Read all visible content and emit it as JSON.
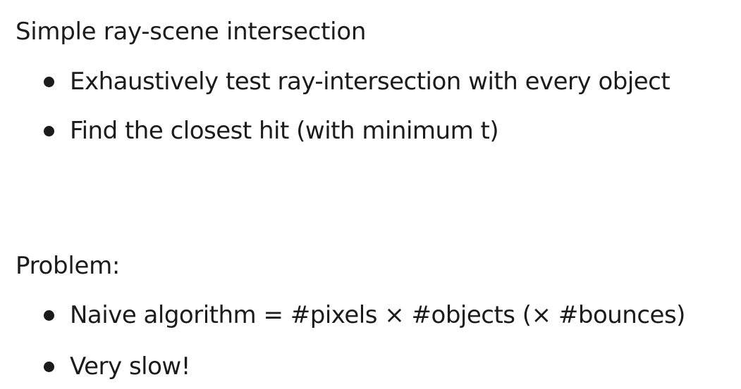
{
  "sections": [
    {
      "title": "Simple ray-scene intersection",
      "bullets": [
        "Exhaustively test ray-intersection with every object",
        "Find the closest hit (with minimum t)"
      ]
    },
    {
      "title": "Problem:",
      "bullets": [
        "Naive algorithm = #pixels × #objects (× #bounces)",
        "Very slow!"
      ]
    }
  ]
}
